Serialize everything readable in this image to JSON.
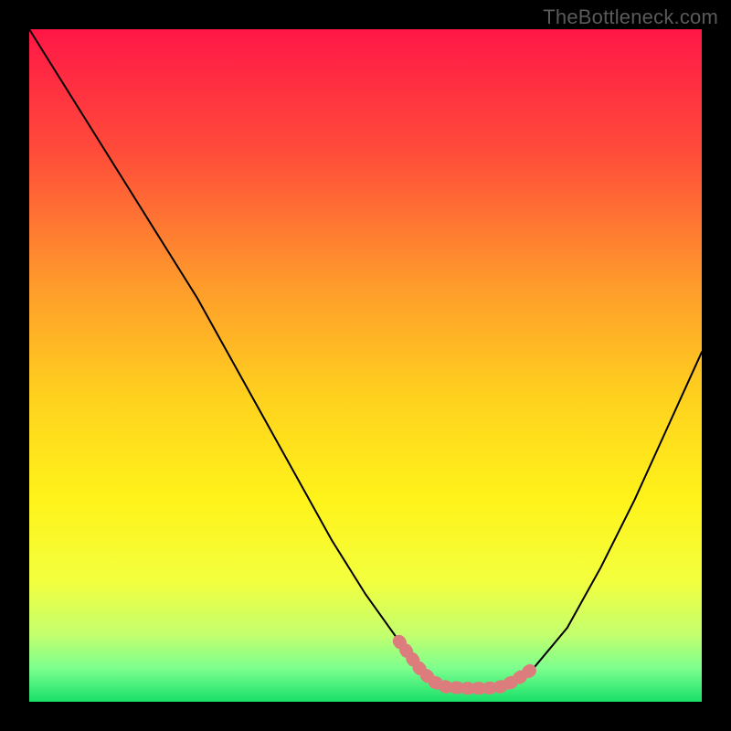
{
  "watermark": "TheBottleneck.com",
  "chart_data": {
    "type": "line",
    "title": "",
    "xlabel": "",
    "ylabel": "",
    "xlim": [
      0,
      100
    ],
    "ylim": [
      0,
      100
    ],
    "grid": false,
    "legend": false,
    "background_gradient_stops": [
      {
        "pos": 0.0,
        "color": "#ff1747"
      },
      {
        "pos": 0.18,
        "color": "#ff4b3a"
      },
      {
        "pos": 0.38,
        "color": "#ff9b2c"
      },
      {
        "pos": 0.55,
        "color": "#ffd21e"
      },
      {
        "pos": 0.7,
        "color": "#fff31a"
      },
      {
        "pos": 0.82,
        "color": "#f3ff3e"
      },
      {
        "pos": 0.9,
        "color": "#c3ff6e"
      },
      {
        "pos": 0.95,
        "color": "#7dff8e"
      },
      {
        "pos": 1.0,
        "color": "#18e06a"
      }
    ],
    "series": [
      {
        "name": "bottleneck-curve",
        "color": "#000000",
        "width": 2,
        "x": [
          0,
          5,
          10,
          15,
          20,
          25,
          30,
          35,
          40,
          45,
          50,
          55,
          58,
          60,
          62,
          65,
          68,
          70,
          72,
          75,
          80,
          85,
          90,
          95,
          100
        ],
        "y": [
          100,
          92,
          84,
          76,
          68,
          60,
          51,
          42,
          33,
          24,
          16,
          9,
          5,
          3,
          2.2,
          2,
          2,
          2.2,
          3,
          5,
          11,
          20,
          30,
          41,
          52
        ]
      }
    ],
    "highlight": {
      "name": "optimal-band",
      "color": "#dd7c7c",
      "width": 14,
      "dash": [
        2,
        10
      ],
      "x": [
        55,
        58,
        60,
        62,
        65,
        68,
        70,
        72,
        75
      ],
      "y": [
        9,
        5,
        3,
        2.2,
        2,
        2,
        2.2,
        3,
        5
      ]
    }
  }
}
